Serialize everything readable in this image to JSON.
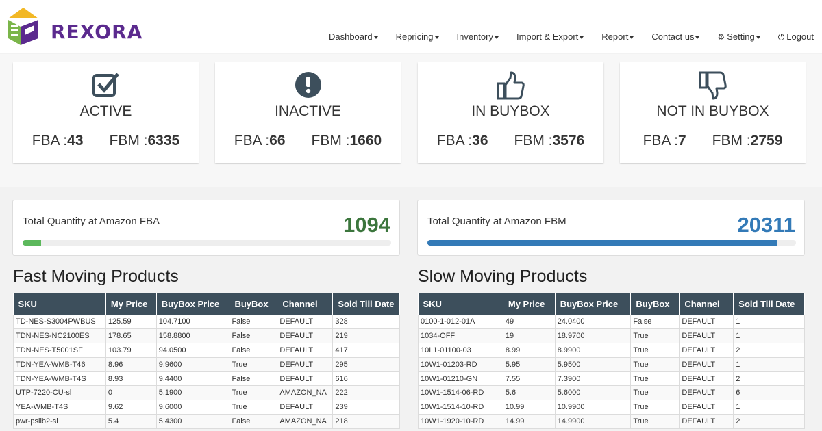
{
  "brand": {
    "name": "REXORA"
  },
  "nav": [
    {
      "label": "Dashboard",
      "caret": true
    },
    {
      "label": "Repricing",
      "caret": true
    },
    {
      "label": "Inventory",
      "caret": true
    },
    {
      "label": "Import & Export",
      "caret": true
    },
    {
      "label": "Report",
      "caret": true
    },
    {
      "label": "Contact us",
      "caret": true
    },
    {
      "label": "Setting",
      "caret": true,
      "icon": "gear-icon"
    },
    {
      "label": "Logout",
      "caret": false,
      "icon": "power-icon"
    }
  ],
  "cards": [
    {
      "title": "ACTIVE",
      "icon": "checkbox-icon",
      "fba_label": "FBA :",
      "fba": "43",
      "fbm_label": "FBM :",
      "fbm": "6335"
    },
    {
      "title": "INACTIVE",
      "icon": "exclamation-circle-icon",
      "fba_label": "FBA :",
      "fba": "66",
      "fbm_label": "FBM :",
      "fbm": "1660"
    },
    {
      "title": "IN BUYBOX",
      "icon": "thumbs-up-icon",
      "fba_label": "FBA :",
      "fba": "36",
      "fbm_label": "FBM :",
      "fbm": "3576"
    },
    {
      "title": "NOT IN BUYBOX",
      "icon": "thumbs-down-icon",
      "fba_label": "FBA :",
      "fba": "7",
      "fbm_label": "FBM :",
      "fbm": "2759"
    }
  ],
  "quantity": {
    "fba": {
      "label": "Total Quantity at Amazon FBA",
      "value": "1094",
      "progress": 0.05,
      "color": "#3c763d",
      "bar_color": "#5cb85c"
    },
    "fbm": {
      "label": "Total Quantity at Amazon FBM",
      "value": "20311",
      "progress": 0.95,
      "color": "#337ab7",
      "bar_color": "#337ab7"
    }
  },
  "fast": {
    "title": "Fast Moving Products",
    "columns": [
      "SKU",
      "My Price",
      "BuyBox Price",
      "BuyBox",
      "Channel",
      "Sold Till Date"
    ],
    "rows": [
      [
        "TD-NES-S3004PWBUS",
        "125.59",
        "104.7100",
        "False",
        "DEFAULT",
        "328"
      ],
      [
        "TDN-NES-NC2100ES",
        "178.65",
        "158.8800",
        "False",
        "DEFAULT",
        "219"
      ],
      [
        "TDN-NES-T5001SF",
        "103.79",
        "94.0500",
        "False",
        "DEFAULT",
        "417"
      ],
      [
        "TDN-YEA-WMB-T46",
        "8.96",
        "9.9600",
        "True",
        "DEFAULT",
        "295"
      ],
      [
        "TDN-YEA-WMB-T4S",
        "8.93",
        "9.4400",
        "False",
        "DEFAULT",
        "616"
      ],
      [
        "UTP-7220-CU-sl",
        "0",
        "5.1900",
        "True",
        "AMAZON_NA",
        "222"
      ],
      [
        "YEA-WMB-T4S",
        "9.62",
        "9.6000",
        "True",
        "DEFAULT",
        "239"
      ],
      [
        "pwr-pslib2-sl",
        "5.4",
        "5.4300",
        "False",
        "AMAZON_NA",
        "218"
      ]
    ]
  },
  "slow": {
    "title": "Slow Moving Products",
    "columns": [
      "SKU",
      "My Price",
      "BuyBox Price",
      "BuyBox",
      "Channel",
      "Sold Till Date"
    ],
    "rows": [
      [
        "0100-1-012-01A",
        "49",
        "24.0400",
        "False",
        "DEFAULT",
        "1"
      ],
      [
        "1034-OFF",
        "19",
        "18.9700",
        "True",
        "DEFAULT",
        "1"
      ],
      [
        "10L1-01100-03",
        "8.99",
        "8.9900",
        "True",
        "DEFAULT",
        "2"
      ],
      [
        "10W1-01203-RD",
        "5.95",
        "5.9500",
        "True",
        "DEFAULT",
        "1"
      ],
      [
        "10W1-01210-GN",
        "7.55",
        "7.3900",
        "True",
        "DEFAULT",
        "2"
      ],
      [
        "10W1-1514-06-RD",
        "5.6",
        "5.6000",
        "True",
        "DEFAULT",
        "6"
      ],
      [
        "10W1-1514-10-RD",
        "10.99",
        "10.9900",
        "True",
        "DEFAULT",
        "1"
      ],
      [
        "10W1-1920-10-RD",
        "14.99",
        "14.9900",
        "True",
        "DEFAULT",
        "2"
      ]
    ]
  }
}
